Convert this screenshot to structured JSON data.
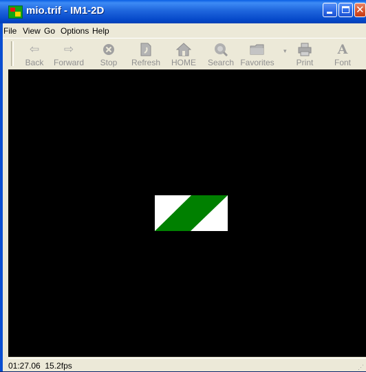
{
  "window": {
    "title": "mio.trif - IM1-2D",
    "controls": {
      "minimize": "minimize",
      "maximize": "maximize",
      "close": "close"
    }
  },
  "menu": [
    "File",
    "View",
    "Go",
    "Options",
    "Help"
  ],
  "toolbar": [
    {
      "label": "Back",
      "icon": "back-arrow"
    },
    {
      "label": "Forward",
      "icon": "forward-arrow"
    },
    {
      "label": "Stop",
      "icon": "stop-circle-x"
    },
    {
      "label": "Refresh",
      "icon": "refresh-page"
    },
    {
      "label": "HOME",
      "icon": "home-house"
    },
    {
      "label": "Search",
      "icon": "search-magnifier"
    },
    {
      "label": "Favorites",
      "icon": "favorites-folder"
    },
    {
      "label": "Print",
      "icon": "printer"
    },
    {
      "label": "Font",
      "icon": "font-A"
    }
  ],
  "viewport": {
    "background": "#000000",
    "shape": {
      "fill": "#ffffff",
      "stripe": "#008000"
    }
  },
  "status": {
    "text": "01:27.06  15.2fps"
  }
}
